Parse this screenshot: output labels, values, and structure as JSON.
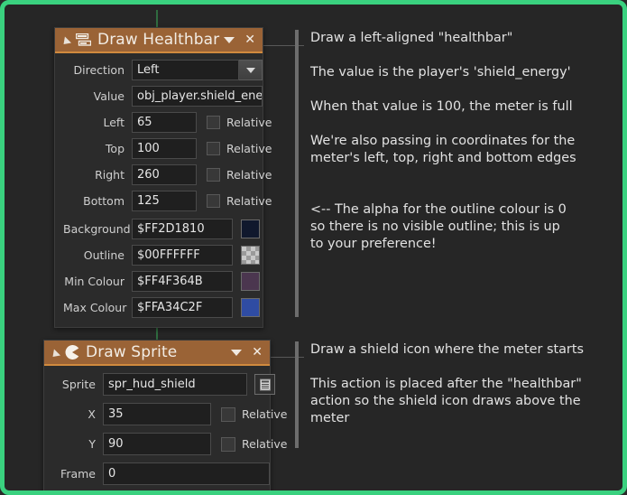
{
  "window": {
    "accent_border": "#3ad17f",
    "background": "#262626",
    "node_header_color": "#9a6336",
    "node_header_underline": "#d08a3e"
  },
  "nodes": [
    {
      "id": "draw-healthbar",
      "title": "Draw Healthbar",
      "icon": "healthbar-icon",
      "collapse_icon": "collapse-triangle-icon",
      "menu_icon": "chevron-down-icon",
      "close_icon": "close-icon",
      "fields": {
        "direction": {
          "label": "Direction",
          "value": "Left",
          "dropdown_icon": "dropdown-caret-icon"
        },
        "value": {
          "label": "Value",
          "value": "obj_player.shield_energy"
        },
        "left": {
          "label": "Left",
          "value": "65",
          "relative_label": "Relative",
          "relative_checked": false
        },
        "top": {
          "label": "Top",
          "value": "100",
          "relative_label": "Relative",
          "relative_checked": false
        },
        "right": {
          "label": "Right",
          "value": "260",
          "relative_label": "Relative",
          "relative_checked": false
        },
        "bottom": {
          "label": "Bottom",
          "value": "125",
          "relative_label": "Relative",
          "relative_checked": false
        },
        "background": {
          "label": "Background",
          "value": "$FF2D1810",
          "swatch": "#10182d"
        },
        "outline": {
          "label": "Outline",
          "value": "$00FFFFFF",
          "swatch": "transparent"
        },
        "min_colour": {
          "label": "Min Colour",
          "value": "$FF4F364B",
          "swatch": "#4b364f"
        },
        "max_colour": {
          "label": "Max Colour",
          "value": "$FFA34C2F",
          "swatch": "#2f4ca3"
        }
      }
    },
    {
      "id": "draw-sprite",
      "title": "Draw Sprite",
      "icon": "sprite-pacman-icon",
      "collapse_icon": "collapse-triangle-icon",
      "menu_icon": "chevron-down-icon",
      "close_icon": "close-icon",
      "fields": {
        "sprite": {
          "label": "Sprite",
          "value": "spr_hud_shield",
          "picker_icon": "sprite-picker-icon"
        },
        "x": {
          "label": "X",
          "value": "35",
          "relative_label": "Relative",
          "relative_checked": false
        },
        "y": {
          "label": "Y",
          "value": "90",
          "relative_label": "Relative",
          "relative_checked": false
        },
        "frame": {
          "label": "Frame",
          "value": "0"
        }
      }
    }
  ],
  "comments": {
    "healthbar": {
      "line1": "Draw a left-aligned \"healthbar\"",
      "line2": "The value is the player's 'shield_energy'",
      "line3": "When that value is 100, the meter is full",
      "line4a": "We're also passing in coordinates for the",
      "line4b": "meter's left, top, right and bottom edges",
      "line5a": "<-- The alpha for the outline colour is 0",
      "line5b": "so there is no visible outline; this is up",
      "line5c": "to your preference!"
    },
    "sprite": {
      "line1": "Draw a shield icon where the meter starts",
      "line2a": "This action is placed after the \"healthbar\"",
      "line2b": "action so the shield icon draws above the",
      "line2c": "meter"
    }
  }
}
